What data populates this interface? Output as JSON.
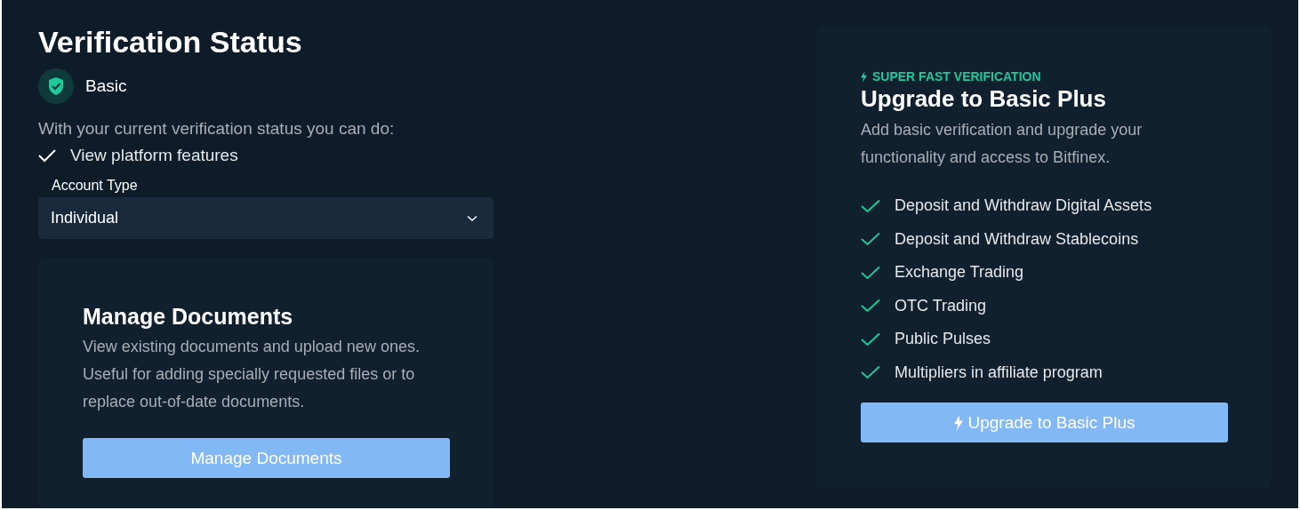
{
  "title": "Verification Status",
  "status": {
    "level_name": "Basic"
  },
  "capabilities": {
    "intro": "With your current verification status you can do:",
    "items": [
      "View platform features"
    ]
  },
  "account_type": {
    "label": "Account Type",
    "value": "Individual"
  },
  "manage_documents": {
    "title": "Manage Documents",
    "description": "View existing documents and upload new ones. Useful for adding specially requested files or to replace out-of-date documents.",
    "button": "Manage Documents"
  },
  "upgrade": {
    "tag": "SUPER FAST VERIFICATION",
    "title": "Upgrade to Basic Plus",
    "description": "Add basic verification and upgrade your functionality and access to Bitfinex.",
    "features": [
      "Deposit and Withdraw Digital Assets",
      "Deposit and Withdraw Stablecoins",
      "Exchange Trading",
      "OTC Trading",
      "Public Pulses",
      "Multipliers in affiliate program"
    ],
    "button": "Upgrade to Basic Plus"
  }
}
